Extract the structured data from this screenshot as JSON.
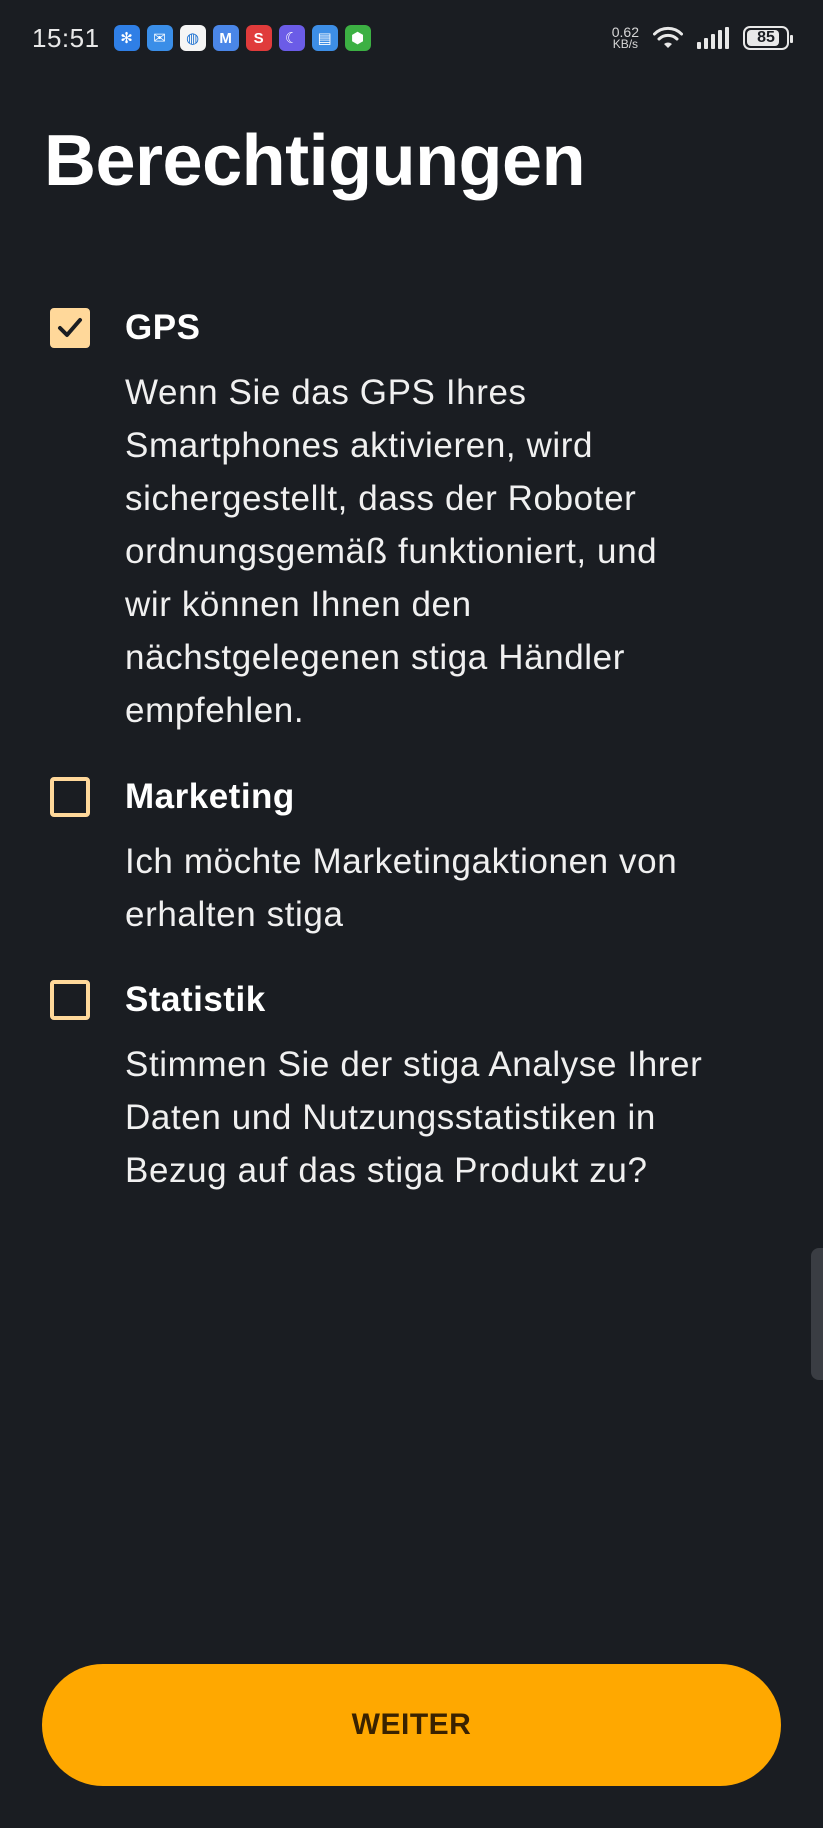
{
  "status_bar": {
    "time": "15:51",
    "notification_icons": [
      {
        "name": "pinwheel-app-icon",
        "glyph": "✻",
        "color": "#2f7fe6"
      },
      {
        "name": "mail-app-icon",
        "glyph": "✉",
        "color": "#3a8ee8"
      },
      {
        "name": "browser-app-icon",
        "glyph": "◍",
        "color": "#f5f5f5"
      },
      {
        "name": "m-mail-app-icon",
        "glyph": "M",
        "color": "#4a86e8"
      },
      {
        "name": "s-app-icon",
        "glyph": "S",
        "color": "#e03b3b"
      },
      {
        "name": "moon-app-icon",
        "glyph": "☾",
        "color": "#6b5ce7"
      },
      {
        "name": "doc-app-icon",
        "glyph": "▤",
        "color": "#3d8ee6"
      },
      {
        "name": "security-app-icon",
        "glyph": "⬢",
        "color": "#3cb043"
      }
    ],
    "net_speed_value": "0.62",
    "net_speed_unit": "KB/s",
    "battery_percent": "85",
    "battery_level": 0.85
  },
  "page": {
    "title": "Berechtigungen"
  },
  "permissions": {
    "gps": {
      "checked": true,
      "title": "GPS",
      "description_lines": [
        "Wenn Sie das GPS Ihres",
        "Smartphones aktivieren, wird",
        "sichergestellt, dass der Roboter",
        "ordnungsgemäß funktioniert, und",
        "wir können Ihnen den",
        "nächstgelegenen stiga Händler",
        "empfehlen."
      ]
    },
    "marketing": {
      "checked": false,
      "title": "Marketing",
      "description_lines": [
        "Ich möchte Marketingaktionen von",
        "erhalten stiga"
      ]
    },
    "statistics": {
      "checked": false,
      "title": "Statistik",
      "description_lines": [
        "Stimmen Sie der stiga Analyse Ihrer",
        "Daten und Nutzungsstatistiken in",
        "Bezug auf das stiga  Produkt zu?"
      ]
    }
  },
  "footer": {
    "continue_label": "WEITER"
  },
  "colors": {
    "background": "#1a1d22",
    "accent": "#ffa800",
    "checkbox": "#ffd89a"
  }
}
